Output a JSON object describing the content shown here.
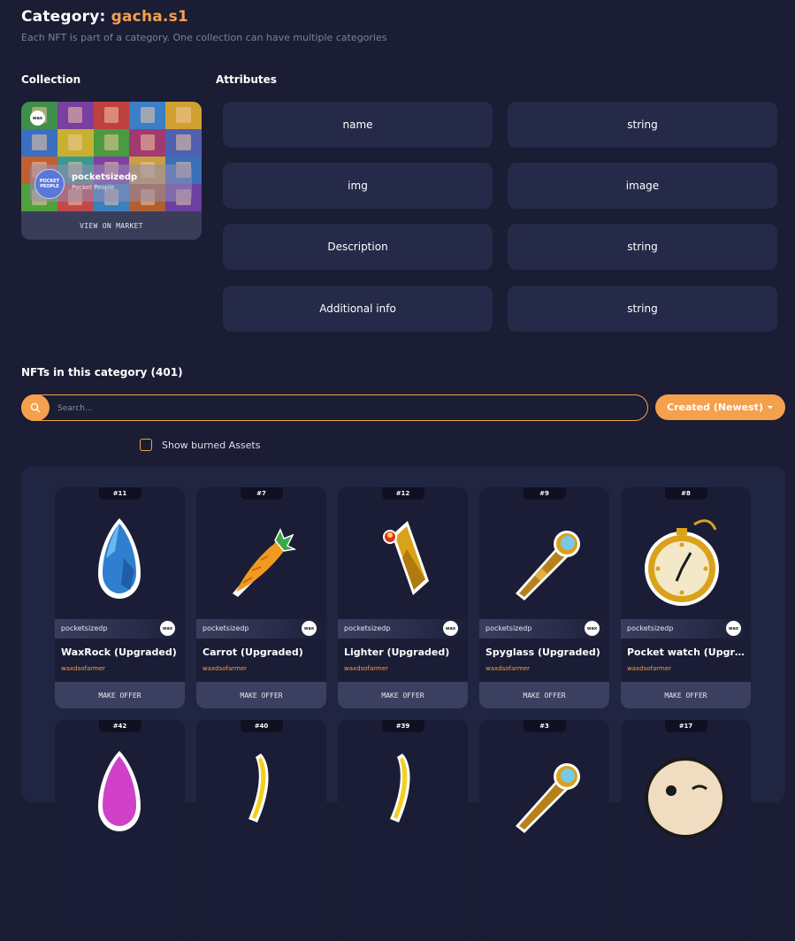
{
  "header": {
    "title_prefix": "Category: ",
    "category_name": "gacha.s1",
    "subtitle": "Each NFT is part of a category. One collection can have multiple categories"
  },
  "collection": {
    "section_label": "Collection",
    "name": "pocketsizedp",
    "display_name": "Pocket People",
    "avatar_text": "POCKET PEOPLE",
    "badge_text": "wax",
    "view_button_label": "VIEW ON MARKET"
  },
  "attributes": {
    "section_label": "Attributes",
    "rows": [
      {
        "name": "name",
        "type": "string"
      },
      {
        "name": "img",
        "type": "image"
      },
      {
        "name": "Description",
        "type": "string"
      },
      {
        "name": "Additional info",
        "type": "string"
      }
    ]
  },
  "nfts": {
    "section_label": "NFTs in this category (401)",
    "search_placeholder": "Search...",
    "sort_label": "Created (Newest)",
    "burned_label": "Show burned Assets",
    "items": [
      {
        "number": "#11",
        "collection": "pocketsizedp",
        "name": "WaxRock (Upgraded)",
        "owner": "waxdsofarmer",
        "offer_label": "MAKE OFFER",
        "icon": "rock-icon"
      },
      {
        "number": "#7",
        "collection": "pocketsizedp",
        "name": "Carrot (Upgraded)",
        "owner": "waxdsofarmer",
        "offer_label": "MAKE OFFER",
        "icon": "carrot-icon"
      },
      {
        "number": "#12",
        "collection": "pocketsizedp",
        "name": "Lighter (Upgraded)",
        "owner": "waxdsofarmer",
        "offer_label": "MAKE OFFER",
        "icon": "lighter-icon"
      },
      {
        "number": "#9",
        "collection": "pocketsizedp",
        "name": "Spyglass (Upgraded)",
        "owner": "waxdsofarmer",
        "offer_label": "MAKE OFFER",
        "icon": "spyglass-icon"
      },
      {
        "number": "#8",
        "collection": "pocketsizedp",
        "name": "Pocket watch (Upgraded)",
        "owner": "waxdsofarmer",
        "offer_label": "MAKE OFFER",
        "icon": "pocket-watch-icon"
      },
      {
        "number": "#42",
        "icon": "rock-icon"
      },
      {
        "number": "#40",
        "icon": "banana-icon"
      },
      {
        "number": "#39",
        "icon": "banana-icon"
      },
      {
        "number": "#3",
        "icon": "spyglass-icon"
      },
      {
        "number": "#17",
        "icon": "face-icon"
      }
    ]
  },
  "colors": {
    "background": "#1a1d33",
    "accent": "#f5a04d",
    "card": "#252a48"
  }
}
